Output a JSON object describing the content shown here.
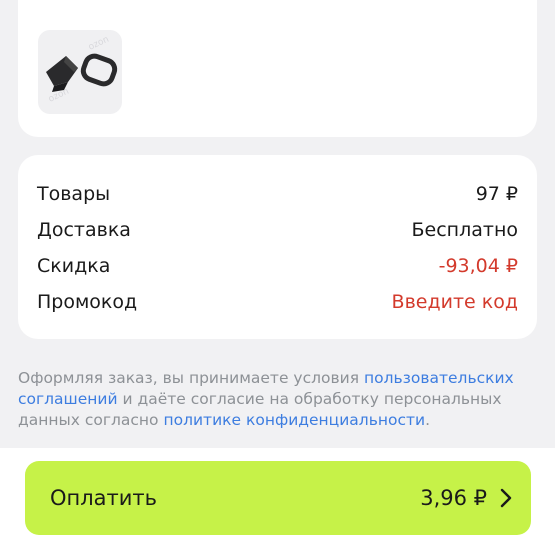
{
  "product": {
    "image_icon": "gasket-product-icon"
  },
  "summary": {
    "rows": [
      {
        "label": "Товары",
        "value": "97 ₽",
        "color": "#1a1a1a"
      },
      {
        "label": "Доставка",
        "value": "Бесплатно",
        "color": "#1a1a1a"
      },
      {
        "label": "Скидка",
        "value": "-93,04 ₽",
        "color": "#d33a2c"
      },
      {
        "label": "Промокод",
        "value": "Введите код",
        "color": "#d33a2c"
      }
    ]
  },
  "terms": {
    "text1": "Оформляя заказ, вы принимаете условия ",
    "link1": "пользовательских соглашений",
    "text2": " и даёте согласие на обработку персональных данных согласно ",
    "link2": "политике конфиденциальности",
    "text3": "."
  },
  "pay_button": {
    "label": "Оплатить",
    "amount": "3,96 ₽",
    "color": "#c6f248",
    "icon": "chevron-right-icon"
  }
}
